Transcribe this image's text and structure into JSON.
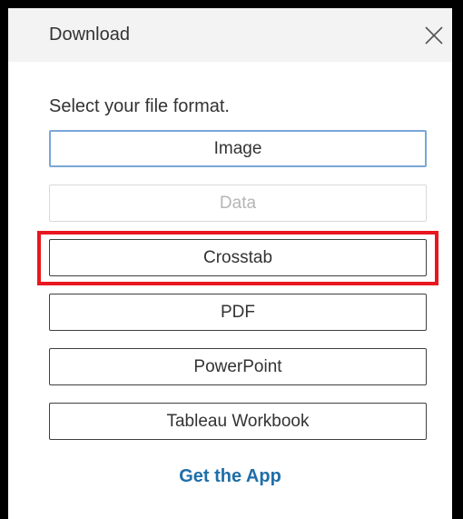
{
  "dialog": {
    "title": "Download",
    "close_icon": "close-x-icon",
    "prompt": "Select your file format.",
    "options": [
      {
        "label": "Image",
        "state": "focused"
      },
      {
        "label": "Data",
        "state": "disabled"
      },
      {
        "label": "Crosstab",
        "state": "highlighted"
      },
      {
        "label": "PDF",
        "state": "normal"
      },
      {
        "label": "PowerPoint",
        "state": "normal"
      },
      {
        "label": "Tableau Workbook",
        "state": "normal"
      }
    ],
    "get_app_link": "Get the App"
  },
  "colors": {
    "header_bg": "#f3f3f3",
    "focus_border": "#7aa7d6",
    "highlight_border": "#e8171f",
    "link": "#1f6fa8",
    "disabled_text": "#b5b5b5"
  }
}
